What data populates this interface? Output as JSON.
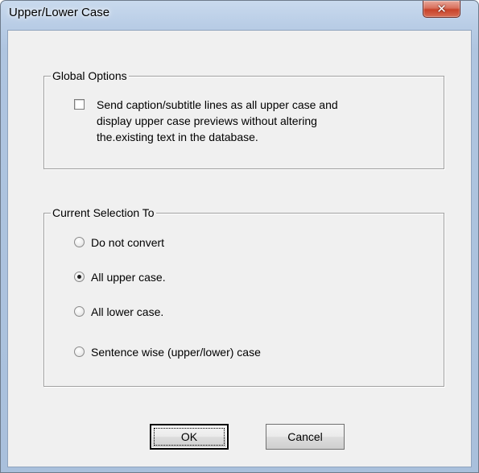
{
  "window": {
    "title": "Upper/Lower Case",
    "close_glyph": "✕",
    "close_icon": "close-icon"
  },
  "global_options": {
    "legend": "Global Options",
    "checkbox": {
      "label_line1": "Send caption/subtitle lines as all upper case and",
      "label_line2": "display upper case previews without altering",
      "label_line3": "the.existing text in the database.",
      "checked": false
    }
  },
  "current_selection": {
    "legend": "Current Selection To",
    "options": [
      {
        "label": "Do not convert",
        "selected": false
      },
      {
        "label": "All upper case.",
        "selected": true
      },
      {
        "label": "All lower case.",
        "selected": false
      },
      {
        "label": "Sentence wise (upper/lower) case",
        "selected": false
      }
    ]
  },
  "buttons": {
    "ok_label": "OK",
    "cancel_label": "Cancel"
  }
}
